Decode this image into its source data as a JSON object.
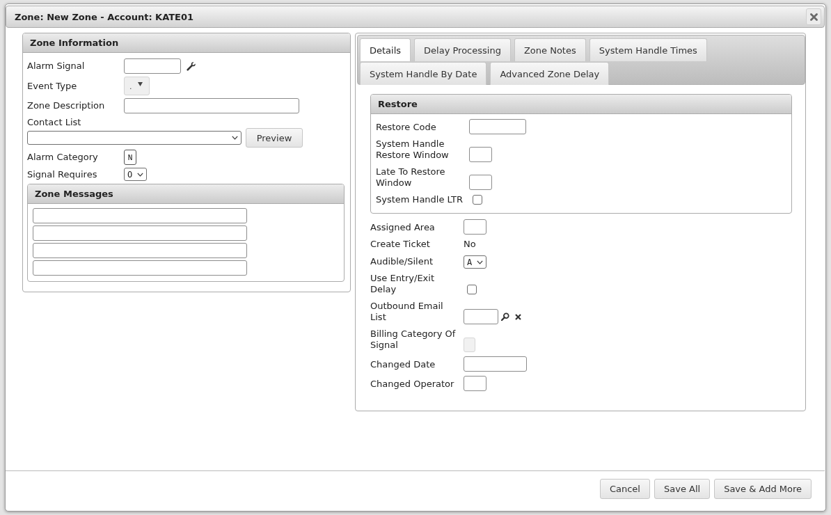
{
  "title": "Zone: New Zone - Account: KATE01",
  "zone_information": {
    "title": "Zone Information",
    "fields": [
      {
        "kind": "lookup",
        "label": "Alarm Signal"
      },
      {
        "kind": "dropdown",
        "label": "Event Type",
        "value": "."
      },
      {
        "kind": "input",
        "label": "Zone Description"
      },
      {
        "kind": "combo",
        "label": "Contact List",
        "button": "Preview"
      },
      {
        "kind": "charbox",
        "label": "Alarm Category",
        "value": "N"
      },
      {
        "kind": "select",
        "label": "Signal Requires",
        "value": "O"
      }
    ]
  },
  "zone_messages": {
    "title": "Zone Messages",
    "fields": [
      {
        "kind": "input"
      },
      {
        "kind": "input"
      },
      {
        "kind": "input"
      },
      {
        "kind": "input"
      }
    ]
  },
  "tabs": [
    {
      "label": "Details",
      "selected": true
    },
    {
      "label": "Delay Processing",
      "selected": false
    },
    {
      "label": "Zone Notes",
      "selected": false
    },
    {
      "label": "System Handle Times",
      "selected": false
    },
    {
      "label": "System Handle By Date",
      "selected": false
    },
    {
      "label": "Advanced Zone Delay",
      "selected": false
    }
  ],
  "restore": {
    "title": "Restore",
    "fields": [
      {
        "kind": "input",
        "label": "Restore Code"
      },
      {
        "kind": "input",
        "label": "System Handle Restore Window"
      },
      {
        "kind": "input",
        "label": "Late To Restore Window"
      },
      {
        "kind": "checkbox",
        "label": "System Handle LTR",
        "checked": false
      }
    ]
  },
  "details": {
    "fields": [
      {
        "kind": "input",
        "label": "Assigned Area",
        "disabled": false
      },
      {
        "kind": "text",
        "label": "Create Ticket",
        "value": "No"
      },
      {
        "kind": "select",
        "label": "Audible/Silent",
        "value": "A"
      },
      {
        "kind": "checkbox",
        "label": "Use Entry/Exit Delay",
        "checked": false
      },
      {
        "kind": "picker",
        "label": "Outbound Email List"
      },
      {
        "kind": "input",
        "label": "Billing Category Of Signal",
        "disabled": true
      },
      {
        "kind": "input",
        "label": "Changed Date",
        "disabled": false
      },
      {
        "kind": "input",
        "label": "Changed Operator",
        "disabled": false
      }
    ]
  },
  "buttons": [
    "Cancel",
    "Save All",
    "Save & Add More"
  ]
}
